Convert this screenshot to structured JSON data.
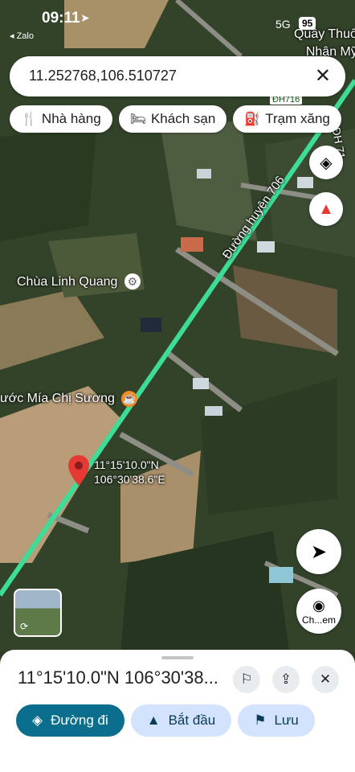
{
  "status_bar": {
    "time": "09:11",
    "back_app": "◂ Zalo",
    "network": "5G",
    "battery": "95"
  },
  "search": {
    "query": "11.252768,106.510727"
  },
  "chips": [
    {
      "icon": "restaurant-icon",
      "glyph": "🍴",
      "label": "Nhà hàng"
    },
    {
      "icon": "hotel-icon",
      "glyph": "🛏",
      "label": "Khách sạn"
    },
    {
      "icon": "gas-station-icon",
      "glyph": "⛽",
      "label": "Trạm xăng"
    }
  ],
  "map": {
    "top_right_labels": [
      "Quầy Thuố",
      "Nhân Mỹ"
    ],
    "road_badge": "ĐH716",
    "road_partial": "ĐH 71",
    "road_name": "Đường huyện 706",
    "poi_temple": "Chùa Linh Quang",
    "poi_cafe": "ước Mía Chị Sương",
    "pin_coords_lat": "11°15'10.0\"N",
    "pin_coords_lng": "106°30'38.6\"E",
    "camera_label": "Ch...em"
  },
  "sheet": {
    "title": "11°15'10.0\"N 106°30'38...",
    "actions": [
      {
        "icon": "directions-icon",
        "glyph": "◈",
        "label": "Đường đi",
        "primary": true
      },
      {
        "icon": "navigate-start-icon",
        "glyph": "▲",
        "label": "Bắt đầu",
        "primary": false
      },
      {
        "icon": "bookmark-icon",
        "glyph": "⚑",
        "label": "Lưu",
        "primary": false
      }
    ]
  },
  "colors": {
    "road": "#3ddc97",
    "pin": "#e53935",
    "primary": "#0b6e8c"
  }
}
